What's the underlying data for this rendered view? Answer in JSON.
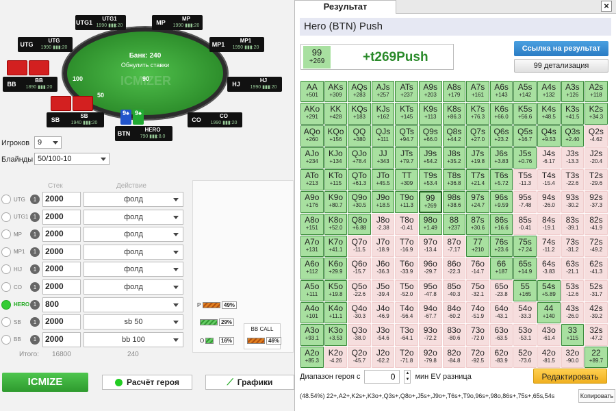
{
  "table": {
    "pot_label": "Банк: 240",
    "reset_label": "Обнулить ставки",
    "watermark": "ICMIZER",
    "seats": [
      {
        "id": "utg",
        "pos": "UTG",
        "name": "UTG",
        "stack": "1990 ▮▮▮:20"
      },
      {
        "id": "utg1",
        "pos": "UTG1",
        "name": "UTG1",
        "stack": "1990 ▮▮▮:20"
      },
      {
        "id": "mp",
        "pos": "MP",
        "name": "MP",
        "stack": "1990 ▮▮▮:20"
      },
      {
        "id": "mp1",
        "pos": "MP1",
        "name": "MP1",
        "stack": "1990 ▮▮▮:20"
      },
      {
        "id": "hj",
        "pos": "HJ",
        "name": "HJ",
        "stack": "1990 ▮▮▮:20"
      },
      {
        "id": "co",
        "pos": "CO",
        "name": "CO",
        "stack": "1990 ▮▮▮:20"
      },
      {
        "id": "btn",
        "pos": "BTN",
        "name": "HERO",
        "stack": "790 ▮▮▮:8.0"
      },
      {
        "id": "sb",
        "pos": "SB",
        "name": "SB",
        "stack": "1940 ▮▮▮:20"
      },
      {
        "id": "bb",
        "pos": "BB",
        "name": "BB",
        "stack": "1890 ▮▮▮:20"
      }
    ],
    "bet_bb": "100",
    "bet_sb": "50",
    "bet_hero": "90",
    "hero_cards": [
      "9♠",
      "9♠"
    ]
  },
  "settings": {
    "players_label": "Игроков",
    "players_value": "9",
    "blinds_label": "Блайнды",
    "blinds_value": "50/100-10",
    "stack_header": "Стек",
    "action_header": "Действие"
  },
  "players": [
    {
      "pos": "UTG",
      "stack": "2000",
      "action": "фолд",
      "active": false
    },
    {
      "pos": "UTG1",
      "stack": "2000",
      "action": "фолд",
      "active": false
    },
    {
      "pos": "MP",
      "stack": "2000",
      "action": "фолд",
      "active": false
    },
    {
      "pos": "MP1",
      "stack": "2000",
      "action": "фолд",
      "active": false
    },
    {
      "pos": "HIJ",
      "stack": "2000",
      "action": "фолд",
      "active": false
    },
    {
      "pos": "CO",
      "stack": "2000",
      "action": "фолд",
      "active": false
    },
    {
      "pos": "HERO",
      "stack": "800",
      "action": "",
      "active": true
    },
    {
      "pos": "SB",
      "stack": "2000",
      "action": "sb 50",
      "active": false
    },
    {
      "pos": "BB",
      "stack": "2000",
      "action": "bb 100",
      "active": false
    }
  ],
  "totals": {
    "label": "Итого:",
    "stack": "16800",
    "action": "240"
  },
  "equity": {
    "p_label": "P",
    "p_value": "49%",
    "mid_value": "29%",
    "o_label": "O",
    "o_value": "16%",
    "bb_call_label": "BB CALL",
    "bb_call_value": "46%"
  },
  "buttons": {
    "icmize": "ICMIZE",
    "hero_calc": "Расчёт героя",
    "charts": "Графики"
  },
  "result": {
    "tab_title": "Результат",
    "header": "Hero (BTN) Push",
    "hand": "99",
    "hand_ev": "+269",
    "summary": "+t269Push",
    "link_btn": "Ссылка на результат",
    "detail_btn": "99 детализация",
    "range_label": "Диапазон героя с",
    "range_value": "0",
    "ev_label": "мин EV разница",
    "edit_btn": "Редактировать",
    "range_text": "(48.54%) 22+,A2+,K2s+,K3o+,Q3s+,Q8o+,J5s+,J9o+,T6s+,T9o,96s+,98o,86s+,75s+,65s,54s",
    "copy_btn": "Копировать",
    "colors": {
      "push": "#a8e0a0",
      "fold": "#f6dede"
    }
  },
  "grid": [
    [
      [
        "AA",
        "+501",
        1
      ],
      [
        "AKs",
        "+309",
        1
      ],
      [
        "AQs",
        "+283",
        1
      ],
      [
        "AJs",
        "+257",
        1
      ],
      [
        "ATs",
        "+237",
        1
      ],
      [
        "A9s",
        "+203",
        1
      ],
      [
        "A8s",
        "+179",
        1
      ],
      [
        "A7s",
        "+161",
        1
      ],
      [
        "A6s",
        "+143",
        1
      ],
      [
        "A5s",
        "+142",
        1
      ],
      [
        "A4s",
        "+132",
        1
      ],
      [
        "A3s",
        "+126",
        1
      ],
      [
        "A2s",
        "+118",
        1
      ]
    ],
    [
      [
        "AKo",
        "+291",
        1
      ],
      [
        "KK",
        "+428",
        1
      ],
      [
        "KQs",
        "+183",
        1
      ],
      [
        "KJs",
        "+162",
        1
      ],
      [
        "KTs",
        "+145",
        1
      ],
      [
        "K9s",
        "+113",
        1
      ],
      [
        "K8s",
        "+86.3",
        1
      ],
      [
        "K7s",
        "+76.3",
        1
      ],
      [
        "K6s",
        "+66.0",
        1
      ],
      [
        "K5s",
        "+56.6",
        1
      ],
      [
        "K4s",
        "+48.5",
        1
      ],
      [
        "K3s",
        "+41.5",
        1
      ],
      [
        "K2s",
        "+34.3",
        1
      ]
    ],
    [
      [
        "AQo",
        "+260",
        1
      ],
      [
        "KQo",
        "+156",
        1
      ],
      [
        "QQ",
        "+380",
        1
      ],
      [
        "QJs",
        "+111",
        1
      ],
      [
        "QTs",
        "+94.7",
        1
      ],
      [
        "Q9s",
        "+66.0",
        1
      ],
      [
        "Q8s",
        "+44.2",
        1
      ],
      [
        "Q7s",
        "+27.0",
        1
      ],
      [
        "Q6s",
        "+23.2",
        1
      ],
      [
        "Q5s",
        "+16.7",
        1
      ],
      [
        "Q4s",
        "+9.53",
        1
      ],
      [
        "Q3s",
        "+2.40",
        1
      ],
      [
        "Q2s",
        "-4.62",
        0
      ]
    ],
    [
      [
        "AJo",
        "+234",
        1
      ],
      [
        "KJo",
        "+134",
        1
      ],
      [
        "QJo",
        "+78.4",
        1
      ],
      [
        "JJ",
        "+343",
        1
      ],
      [
        "JTs",
        "+79.7",
        1
      ],
      [
        "J9s",
        "+54.2",
        1
      ],
      [
        "J8s",
        "+35.2",
        1
      ],
      [
        "J7s",
        "+19.8",
        1
      ],
      [
        "J6s",
        "+3.83",
        1
      ],
      [
        "J5s",
        "+0.76",
        1
      ],
      [
        "J4s",
        "-6.17",
        0
      ],
      [
        "J3s",
        "-13.3",
        0
      ],
      [
        "J2s",
        "-20.4",
        0
      ]
    ],
    [
      [
        "ATo",
        "+213",
        1
      ],
      [
        "KTo",
        "+115",
        1
      ],
      [
        "QTo",
        "+61.3",
        1
      ],
      [
        "JTo",
        "+45.5",
        1
      ],
      [
        "TT",
        "+309",
        1
      ],
      [
        "T9s",
        "+53.4",
        1
      ],
      [
        "T8s",
        "+36.8",
        1
      ],
      [
        "T7s",
        "+21.4",
        1
      ],
      [
        "T6s",
        "+5.72",
        1
      ],
      [
        "T5s",
        "-11.3",
        0
      ],
      [
        "T4s",
        "-15.4",
        0
      ],
      [
        "T3s",
        "-22.6",
        0
      ],
      [
        "T2s",
        "-29.6",
        0
      ]
    ],
    [
      [
        "A9o",
        "+176",
        1
      ],
      [
        "K9o",
        "+80.7",
        1
      ],
      [
        "Q9o",
        "+30.5",
        1
      ],
      [
        "J9o",
        "+18.5",
        1
      ],
      [
        "T9o",
        "+11.3",
        1
      ],
      [
        "99",
        "+269",
        1
      ],
      [
        "98s",
        "+38.6",
        1
      ],
      [
        "97s",
        "+24.7",
        1
      ],
      [
        "96s",
        "+9.59",
        1
      ],
      [
        "95s",
        "-7.48",
        0
      ],
      [
        "94s",
        "-26.0",
        0
      ],
      [
        "93s",
        "-30.2",
        0
      ],
      [
        "92s",
        "-37.3",
        0
      ]
    ],
    [
      [
        "A8o",
        "+151",
        1
      ],
      [
        "K8o",
        "+52.0",
        1
      ],
      [
        "Q8o",
        "+6.88",
        1
      ],
      [
        "J8o",
        "-2.38",
        0
      ],
      [
        "T8o",
        "-0.41",
        0
      ],
      [
        "98o",
        "+1.49",
        1
      ],
      [
        "88",
        "+237",
        1
      ],
      [
        "87s",
        "+30.6",
        1
      ],
      [
        "86s",
        "+16.6",
        1
      ],
      [
        "85s",
        "-0.41",
        0
      ],
      [
        "84s",
        "-19.1",
        0
      ],
      [
        "83s",
        "-39.1",
        0
      ],
      [
        "82s",
        "-41.9",
        0
      ]
    ],
    [
      [
        "A7o",
        "+131",
        1
      ],
      [
        "K7o",
        "+41.1",
        1
      ],
      [
        "Q7o",
        "-11.5",
        0
      ],
      [
        "J7o",
        "-18.9",
        0
      ],
      [
        "T7o",
        "-16.9",
        0
      ],
      [
        "97o",
        "-13.4",
        0
      ],
      [
        "87o",
        "-7.17",
        0
      ],
      [
        "77",
        "+210",
        1
      ],
      [
        "76s",
        "+23.6",
        1
      ],
      [
        "75s",
        "+7.24",
        1
      ],
      [
        "74s",
        "-11.2",
        0
      ],
      [
        "73s",
        "-31.2",
        0
      ],
      [
        "72s",
        "-49.2",
        0
      ]
    ],
    [
      [
        "A6o",
        "+112",
        1
      ],
      [
        "K6o",
        "+29.9",
        1
      ],
      [
        "Q6o",
        "-15.7",
        0
      ],
      [
        "J6o",
        "-36.3",
        0
      ],
      [
        "T6o",
        "-33.9",
        0
      ],
      [
        "96o",
        "-29.7",
        0
      ],
      [
        "86o",
        "-22.3",
        0
      ],
      [
        "76o",
        "-14.7",
        0
      ],
      [
        "66",
        "+187",
        1
      ],
      [
        "65s",
        "+14.9",
        1
      ],
      [
        "64s",
        "-3.83",
        0
      ],
      [
        "63s",
        "-21.1",
        0
      ],
      [
        "62s",
        "-41.3",
        0
      ]
    ],
    [
      [
        "A5o",
        "+111",
        1
      ],
      [
        "K5o",
        "+19.8",
        1
      ],
      [
        "Q5o",
        "-22.6",
        0
      ],
      [
        "J5o",
        "-39.4",
        0
      ],
      [
        "T5o",
        "-52.0",
        0
      ],
      [
        "95o",
        "-47.8",
        0
      ],
      [
        "85o",
        "-40.3",
        0
      ],
      [
        "75o",
        "-32.1",
        0
      ],
      [
        "65o",
        "-23.8",
        0
      ],
      [
        "55",
        "+165",
        1
      ],
      [
        "54s",
        "+5.89",
        1
      ],
      [
        "53s",
        "-12.6",
        0
      ],
      [
        "52s",
        "-31.7",
        0
      ]
    ],
    [
      [
        "A4o",
        "+101",
        1
      ],
      [
        "K4o",
        "+11.1",
        1
      ],
      [
        "Q4o",
        "-30.3",
        0
      ],
      [
        "J4o",
        "-46.9",
        0
      ],
      [
        "T4o",
        "-56.4",
        0
      ],
      [
        "94o",
        "-67.7",
        0
      ],
      [
        "84o",
        "-60.2",
        0
      ],
      [
        "74o",
        "-51.9",
        0
      ],
      [
        "64o",
        "-43.1",
        0
      ],
      [
        "54o",
        "-33.3",
        0
      ],
      [
        "44",
        "+140",
        1
      ],
      [
        "43s",
        "-26.0",
        0
      ],
      [
        "42s",
        "-39.2",
        0
      ]
    ],
    [
      [
        "A3o",
        "+93.1",
        1
      ],
      [
        "K3o",
        "+3.53",
        1
      ],
      [
        "Q3o",
        "-38.0",
        0
      ],
      [
        "J3o",
        "-54.6",
        0
      ],
      [
        "T3o",
        "-64.1",
        0
      ],
      [
        "93o",
        "-72.2",
        0
      ],
      [
        "83o",
        "-80.6",
        0
      ],
      [
        "73o",
        "-72.0",
        0
      ],
      [
        "63o",
        "-63.5",
        0
      ],
      [
        "53o",
        "-53.1",
        0
      ],
      [
        "43o",
        "-61.4",
        0
      ],
      [
        "33",
        "+115",
        1
      ],
      [
        "32s",
        "-47.2",
        0
      ]
    ],
    [
      [
        "A2o",
        "+85.3",
        1
      ],
      [
        "K2o",
        "-4.26",
        0
      ],
      [
        "Q2o",
        "-45.7",
        0
      ],
      [
        "J2o",
        "-62.2",
        0
      ],
      [
        "T2o",
        "-71.8",
        0
      ],
      [
        "92o",
        "-79.8",
        0
      ],
      [
        "82o",
        "-84.8",
        0
      ],
      [
        "72o",
        "-92.5",
        0
      ],
      [
        "62o",
        "-83.9",
        0
      ],
      [
        "52o",
        "-73.6",
        0
      ],
      [
        "42o",
        "-81.5",
        0
      ],
      [
        "32o",
        "-90.0",
        0
      ],
      [
        "22",
        "+89.7",
        1
      ]
    ]
  ]
}
